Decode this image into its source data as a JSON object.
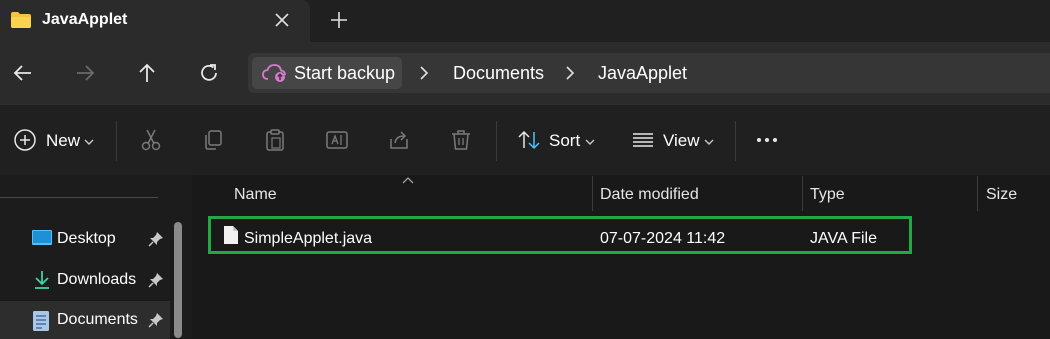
{
  "tab": {
    "title": "JavaApplet"
  },
  "breadcrumb": {
    "backup_label": "Start backup",
    "items": [
      "Documents",
      "JavaApplet"
    ]
  },
  "toolbar": {
    "new_label": "New",
    "sort_label": "Sort",
    "view_label": "View"
  },
  "sidebar": {
    "items": [
      {
        "label": "Desktop",
        "icon": "desktop-icon"
      },
      {
        "label": "Downloads",
        "icon": "downloads-icon"
      },
      {
        "label": "Documents",
        "icon": "documents-icon"
      }
    ]
  },
  "columns": {
    "name": "Name",
    "date": "Date modified",
    "type": "Type",
    "size": "Size"
  },
  "files": [
    {
      "name": "SimpleApplet.java",
      "date": "07-07-2024 11:42",
      "type": "JAVA File",
      "size": ""
    }
  ],
  "colors": {
    "highlight": "#22a845",
    "folder": "#f5c243",
    "accent": "#4cc2ff"
  }
}
